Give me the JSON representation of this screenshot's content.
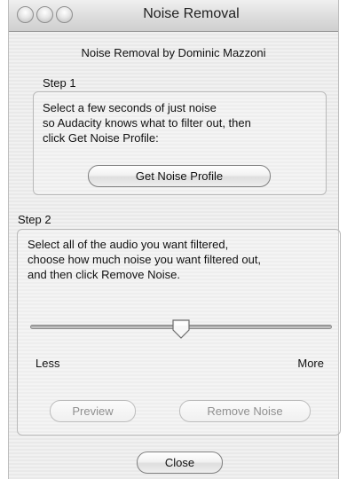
{
  "window": {
    "title": "Noise Removal"
  },
  "header": {
    "subtitle": "Noise Removal by Dominic Mazzoni"
  },
  "step1": {
    "label": "Step 1",
    "lines": [
      "Select a few seconds of just noise",
      "so Audacity knows what to filter out, then",
      "click Get Noise Profile:"
    ],
    "button": "Get Noise Profile"
  },
  "step2": {
    "label": "Step 2",
    "lines": [
      "Select all of the audio you want filtered,",
      "choose how much noise you want filtered out,",
      "and then click Remove Noise."
    ],
    "slider": {
      "min_label": "Less",
      "max_label": "More",
      "value": 0.5
    },
    "preview_button": "Preview",
    "remove_button": "Remove Noise"
  },
  "footer": {
    "close_button": "Close"
  }
}
